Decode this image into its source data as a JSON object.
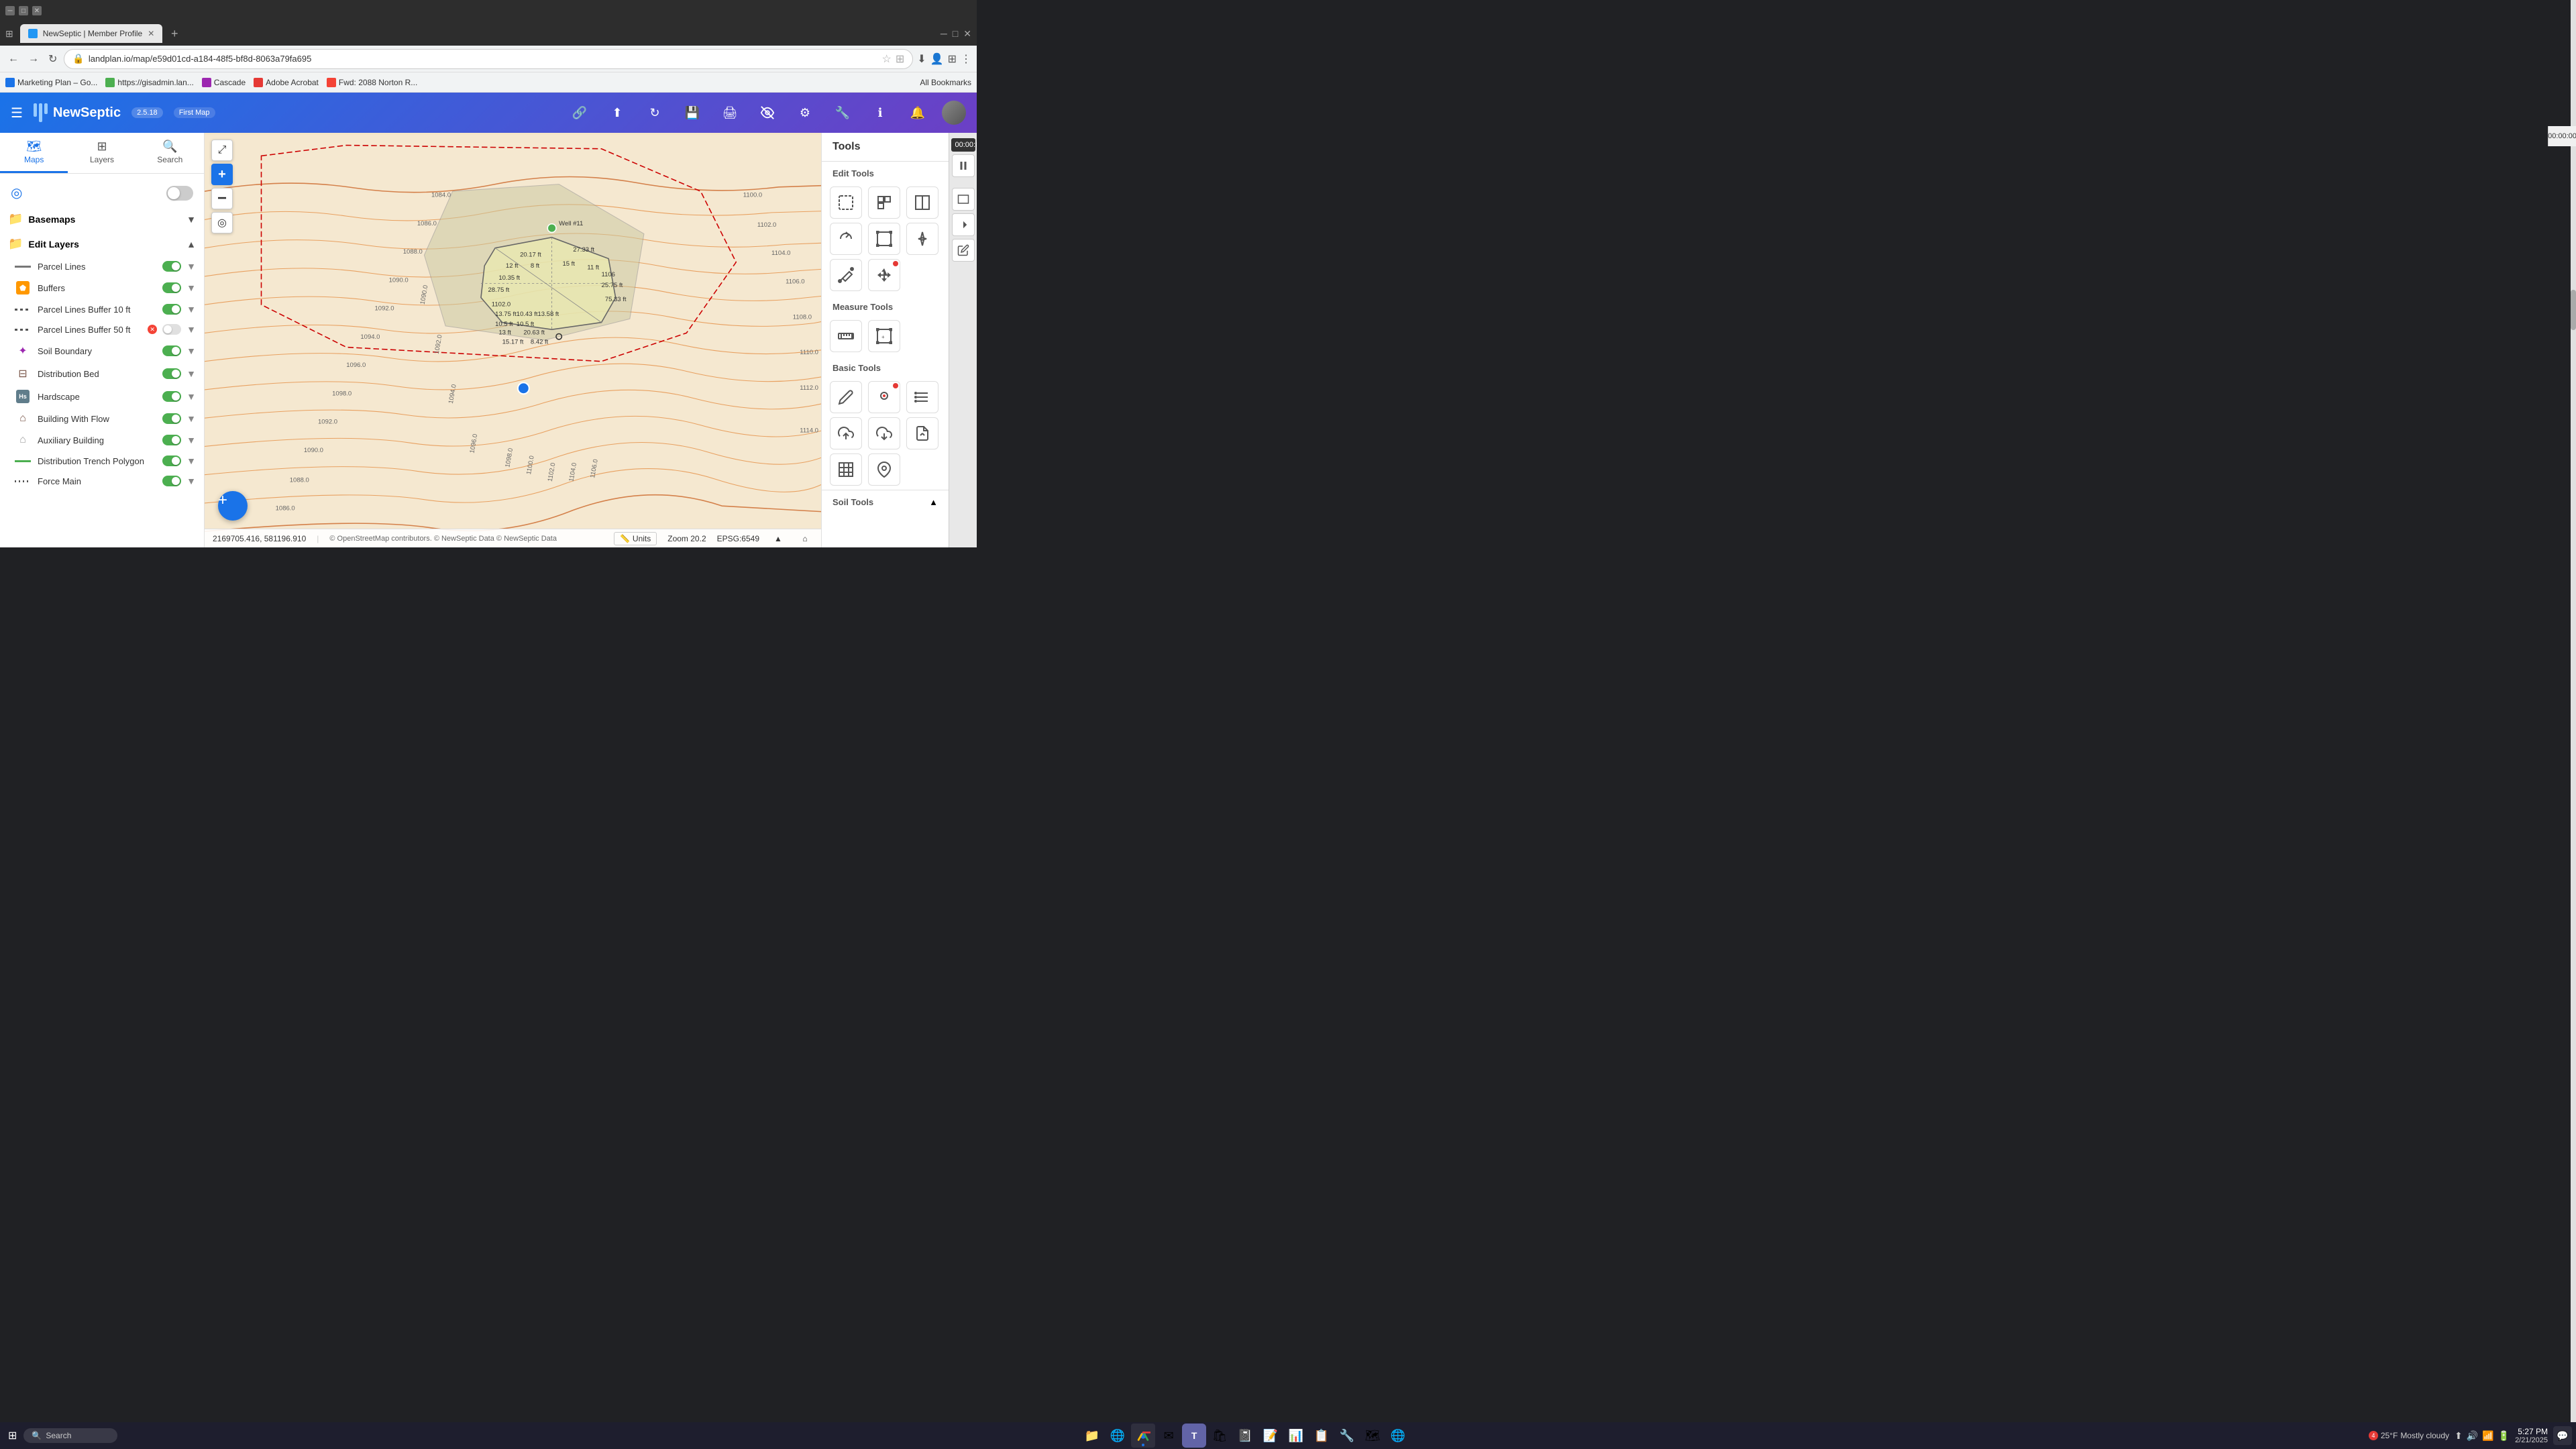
{
  "browser": {
    "tab_title": "NewSeptic | Member Profile",
    "tab_favicon_color": "#2196F3",
    "address": "landplan.io/map/e59d01cd-a184-48f5-bf8d-8063a79fa695",
    "nav_back": "←",
    "nav_forward": "→",
    "nav_refresh": "↻",
    "bookmarks": [
      {
        "label": "Marketing Plan – Go...",
        "icon_color": "#1a73e8"
      },
      {
        "label": "https://gisadmin.lan...",
        "icon_color": "#4CAF50"
      },
      {
        "label": "Cascade",
        "icon_color": "#9c27b0"
      },
      {
        "label": "Adobe Acrobat",
        "icon_color": "#e53935"
      },
      {
        "label": "Fwd: 2088 Norton R...",
        "icon_color": "#f44336"
      },
      {
        "label": "All Bookmarks"
      }
    ]
  },
  "app": {
    "title": "NewSeptic",
    "version": "2.5.18",
    "first_map_label": "First Map"
  },
  "header_icons": [
    "🔗",
    "⬆",
    "↻",
    "💾",
    "🖨",
    "👁",
    "⚙",
    "🔧",
    "ℹ",
    "🔔"
  ],
  "sidebar": {
    "tabs": [
      {
        "label": "Maps",
        "icon": "🗺"
      },
      {
        "label": "Layers",
        "icon": "⊞"
      },
      {
        "label": "Search",
        "icon": "🔍"
      }
    ],
    "basemaps_label": "Basemaps",
    "edit_layers_label": "Edit Layers",
    "layers": [
      {
        "name": "Parcel Lines",
        "type": "line",
        "visible": true,
        "line_color": "#555"
      },
      {
        "name": "Buffers",
        "type": "icon",
        "icon": "⬟",
        "icon_color": "#ff9800",
        "visible": true
      },
      {
        "name": "Parcel Lines Buffer 10 ft",
        "type": "dashed",
        "visible": true
      },
      {
        "name": "Parcel Lines Buffer 50 ft",
        "type": "dashed",
        "visible": false,
        "x_badge": true
      },
      {
        "name": "Soil Boundary",
        "type": "icon",
        "icon": "✦",
        "icon_color": "#9c27b0",
        "visible": true
      },
      {
        "name": "Distribution Bed",
        "type": "icon",
        "icon": "⊟",
        "icon_color": "#795548",
        "visible": true
      },
      {
        "name": "Hardscape",
        "type": "text_icon",
        "text": "Hs",
        "icon_color": "#607d8b",
        "visible": true
      },
      {
        "name": "Building With Flow",
        "type": "icon",
        "icon": "⌂",
        "icon_color": "#795548",
        "visible": true
      },
      {
        "name": "Auxiliary Building",
        "type": "icon",
        "icon": "⌂",
        "icon_color": "#9e9e9e",
        "visible": true
      },
      {
        "name": "Distribution Trench Polygon",
        "type": "line",
        "visible": true,
        "line_color": "#4CAF50"
      },
      {
        "name": "Force Main",
        "type": "dotted",
        "visible": true
      }
    ]
  },
  "tools": {
    "title": "Tools",
    "timer": "00:00:00",
    "sections": [
      {
        "label": "Edit Tools",
        "tools": [
          {
            "icon": "⬚",
            "name": "select-tool"
          },
          {
            "icon": "⊞",
            "name": "multi-select-tool"
          },
          {
            "icon": "✂",
            "name": "split-tool"
          },
          {
            "icon": "↺",
            "name": "undo-tool"
          },
          {
            "icon": "📋",
            "name": "paste-tool"
          },
          {
            "icon": "✏",
            "name": "edit-vertex-tool"
          },
          {
            "icon": "✏",
            "name": "draw-tool"
          },
          {
            "icon": "↗",
            "name": "move-tool"
          }
        ]
      },
      {
        "label": "Measure Tools",
        "tools": [
          {
            "icon": "📏",
            "name": "measure-length-tool"
          },
          {
            "icon": "⊕",
            "name": "measure-area-tool"
          }
        ]
      },
      {
        "label": "Basic Tools",
        "tools": [
          {
            "icon": "✏",
            "name": "pencil-tool"
          },
          {
            "icon": "🖱",
            "name": "pointer-tool"
          },
          {
            "icon": "≡",
            "name": "list-tool"
          },
          {
            "icon": "☁",
            "name": "cloud-upload-tool"
          },
          {
            "icon": "⬇",
            "name": "cloud-download-tool"
          },
          {
            "icon": "📄",
            "name": "file-tool"
          },
          {
            "icon": "⬚",
            "name": "grid-tool"
          },
          {
            "icon": "📍",
            "name": "pin-tool"
          }
        ]
      }
    ],
    "soil_tools_label": "Soil Tools"
  },
  "map": {
    "coordinates": "2169705.416, 581196.910",
    "zoom": "Zoom 20.2",
    "epsg": "EPSG:6549",
    "units_label": "Units",
    "attribution": "© OpenStreetMap contributors. © NewSeptic Data © NewSeptic Data",
    "blue_dot_label": "Well #11"
  },
  "status_bar": {
    "time": "5:27 PM",
    "date": "2/21/2025",
    "weather_temp": "25°F",
    "weather_desc": "Mostly cloudy",
    "weather_badge": "4"
  }
}
